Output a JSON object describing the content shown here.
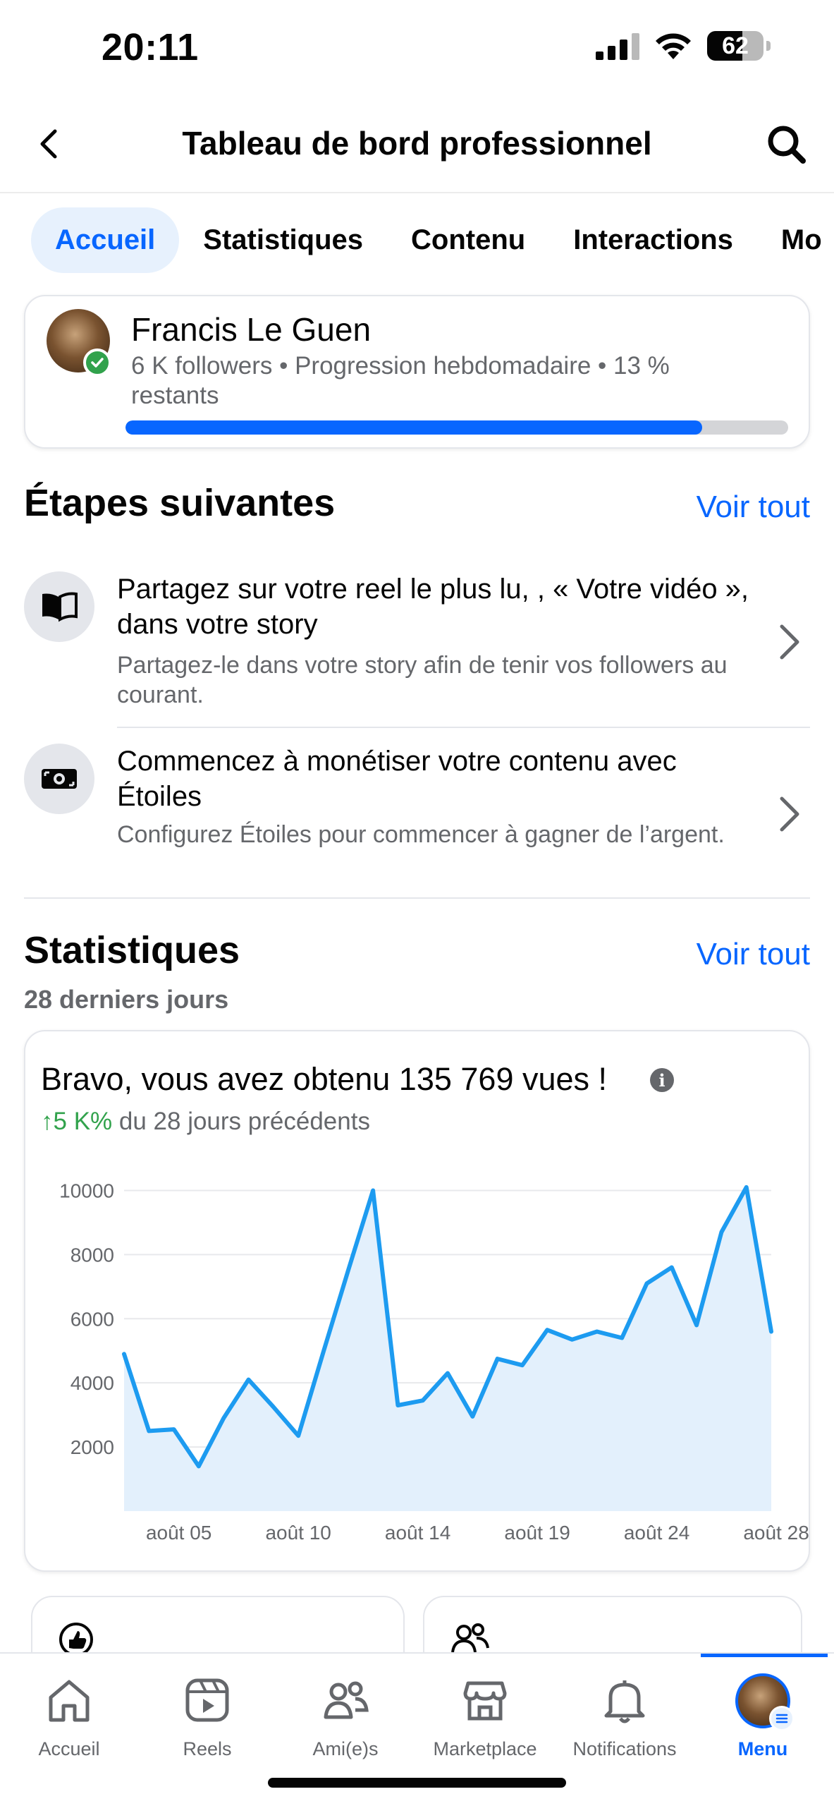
{
  "status_bar": {
    "time": "20:11",
    "battery": "62"
  },
  "header": {
    "title": "Tableau de bord professionnel"
  },
  "tabs": [
    {
      "label": "Accueil",
      "active": true
    },
    {
      "label": "Statistiques"
    },
    {
      "label": "Contenu"
    },
    {
      "label": "Interactions"
    },
    {
      "label": "Mo"
    }
  ],
  "profile": {
    "name": "Francis Le Guen",
    "subtitle": "6 K followers • Progression hebdomadaire • 13 % restants",
    "progress": 0.87
  },
  "next_steps": {
    "title": "Étapes suivantes",
    "see_all": "Voir tout",
    "items": [
      {
        "icon": "book-icon",
        "title": "Partagez sur votre reel le plus lu, , « Votre vidéo », dans votre story",
        "desc": "Partagez-le dans votre story afin de tenir vos followers au courant."
      },
      {
        "icon": "money-icon",
        "title": "Commencez à monétiser votre contenu avec Étoiles",
        "desc": "Configurez Étoiles pour commencer à gagner de l’argent."
      }
    ]
  },
  "statistics": {
    "title": "Statistiques",
    "see_all": "Voir tout",
    "period": "28 derniers jours",
    "headline": "Bravo, vous avez obtenu 135 769 vues !",
    "change_value": "↑5 K%",
    "change_text": " du 28 jours précédents"
  },
  "chart_data": {
    "type": "area",
    "title": "",
    "xlabel": "",
    "ylabel": "",
    "color": "#1d9bf0",
    "fill": "#e3f0fc",
    "ylim": [
      0,
      11000
    ],
    "yticks": [
      2000,
      4000,
      6000,
      8000,
      10000
    ],
    "xtick_labels": [
      "août 05",
      "août 10",
      "août 14",
      "août 19",
      "août 24",
      "août 28"
    ],
    "xtick_index": [
      2.2,
      7.0,
      11.8,
      16.6,
      21.4,
      26.2
    ],
    "values": [
      4900,
      2500,
      2550,
      1400,
      2900,
      4100,
      3250,
      2350,
      4950,
      7500,
      10000,
      3300,
      3450,
      4300,
      2950,
      4750,
      4550,
      5650,
      5350,
      5600,
      5400,
      7100,
      7600,
      5800,
      8700,
      10100,
      5600
    ]
  },
  "bottom_nav": [
    {
      "label": "Accueil",
      "icon": "home-icon"
    },
    {
      "label": "Reels",
      "icon": "reels-icon"
    },
    {
      "label": "Ami(e)s",
      "icon": "friends-icon"
    },
    {
      "label": "Marketplace",
      "icon": "marketplace-icon"
    },
    {
      "label": "Notifications",
      "icon": "bell-icon"
    },
    {
      "label": "Menu",
      "icon": "menu-avatar",
      "active": true
    }
  ]
}
